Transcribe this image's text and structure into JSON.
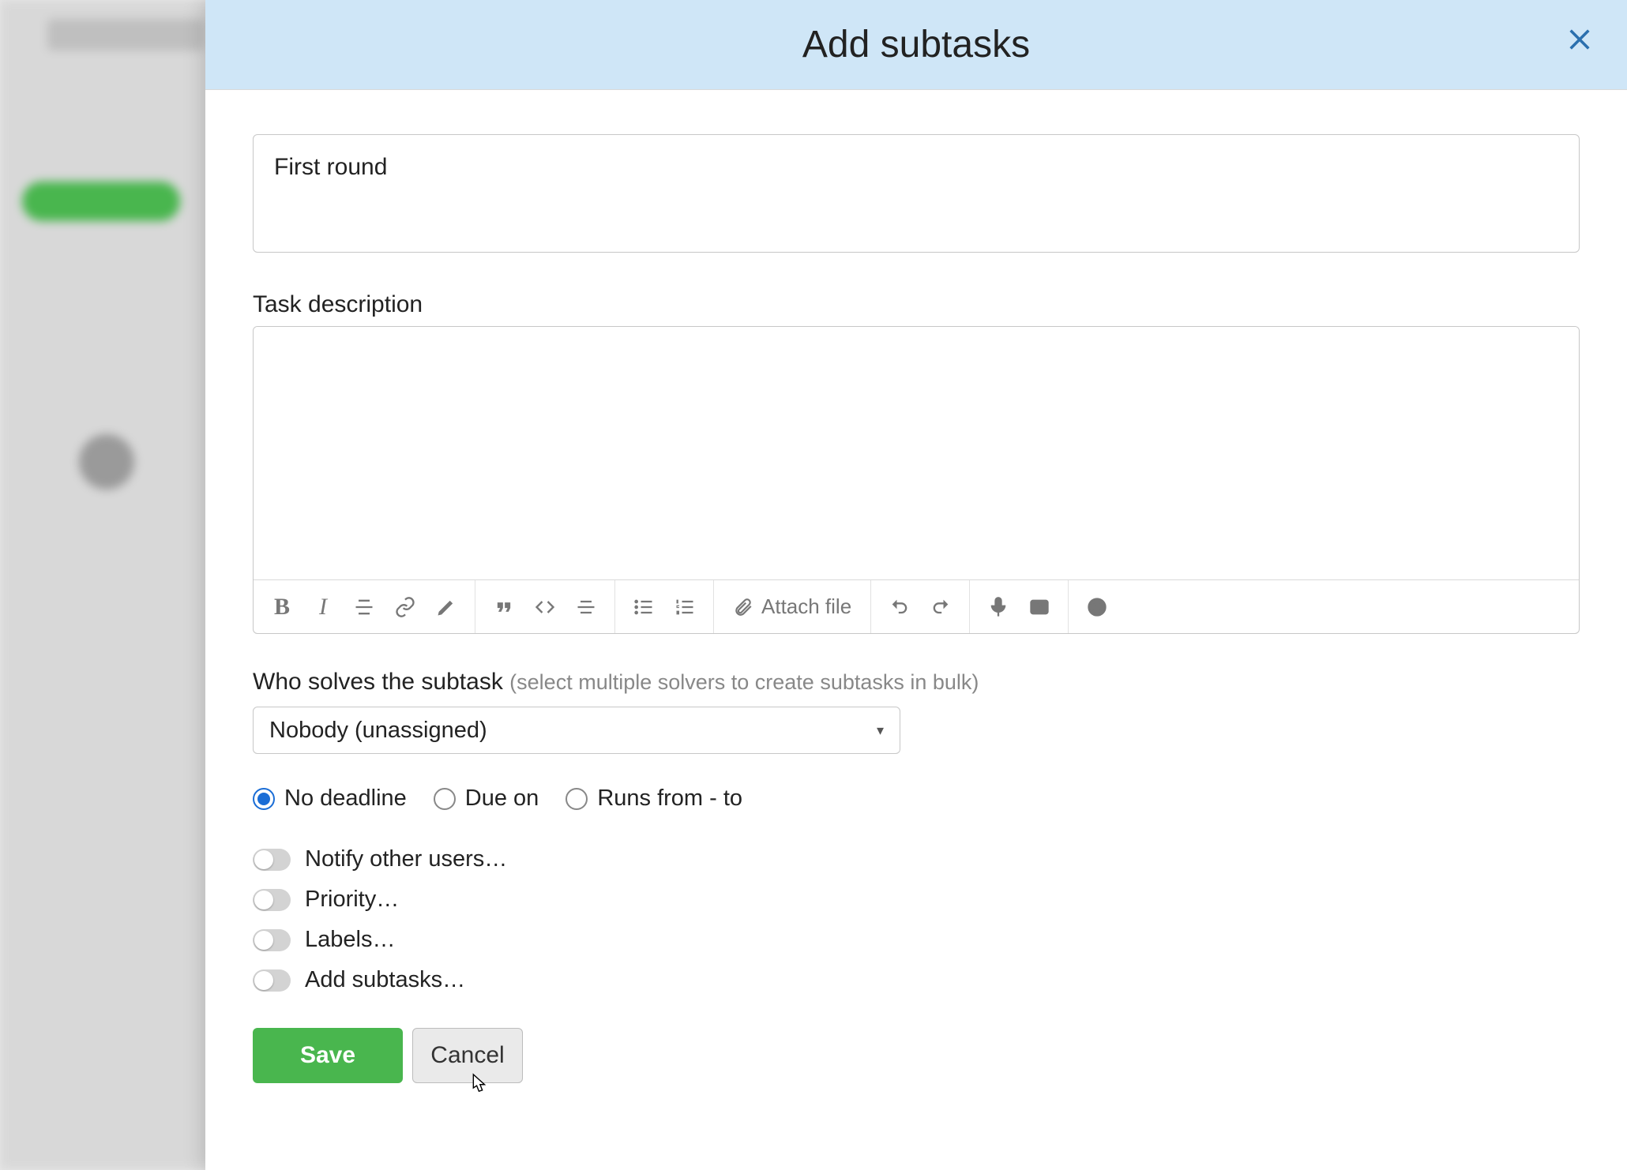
{
  "modal": {
    "title": "Add subtasks",
    "task_name_value": "First round",
    "description_label": "Task description",
    "description_value": "",
    "toolbar": {
      "attach_label": "Attach file"
    },
    "solver": {
      "label": "Who solves the subtask",
      "hint": "(select multiple solvers to create subtasks in bulk)",
      "selected": "Nobody (unassigned)"
    },
    "deadline": {
      "options": [
        "No deadline",
        "Due on",
        "Runs from - to"
      ],
      "selected_index": 0
    },
    "toggles": [
      "Notify other users…",
      "Priority…",
      "Labels…",
      "Add subtasks…"
    ],
    "buttons": {
      "save": "Save",
      "cancel": "Cancel"
    }
  }
}
